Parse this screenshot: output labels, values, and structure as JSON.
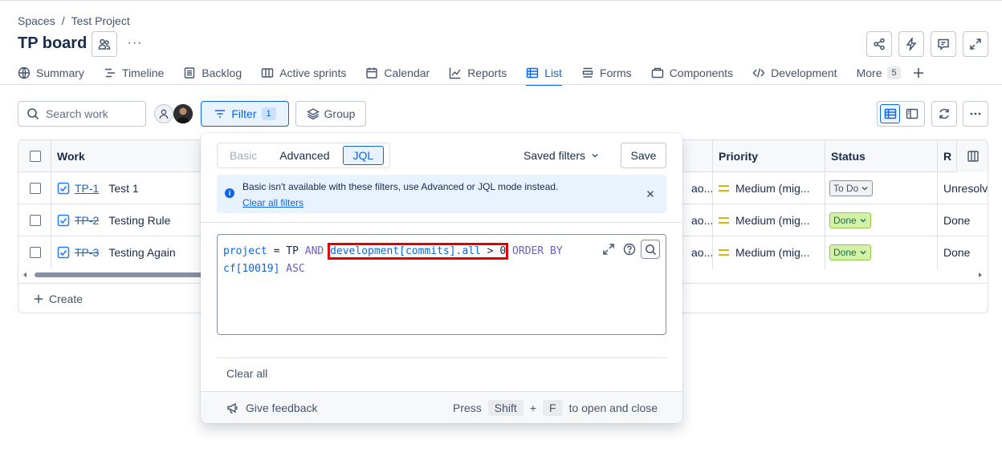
{
  "breadcrumb": {
    "root": "Spaces",
    "separator": "/",
    "project": "Test Project"
  },
  "board": {
    "title": "TP board",
    "more_label": "···"
  },
  "tabs": [
    {
      "label": "Summary",
      "icon": "globe-icon"
    },
    {
      "label": "Timeline",
      "icon": "timeline-icon"
    },
    {
      "label": "Backlog",
      "icon": "backlog-icon"
    },
    {
      "label": "Active sprints",
      "icon": "board-icon"
    },
    {
      "label": "Calendar",
      "icon": "calendar-icon"
    },
    {
      "label": "Reports",
      "icon": "chart-icon"
    },
    {
      "label": "List",
      "icon": "list-icon",
      "active": true
    },
    {
      "label": "Forms",
      "icon": "forms-icon"
    },
    {
      "label": "Components",
      "icon": "components-icon"
    },
    {
      "label": "Development",
      "icon": "code-icon"
    },
    {
      "label": "More",
      "count": "5"
    }
  ],
  "toolbar": {
    "search_placeholder": "Search work",
    "filter_label": "Filter",
    "filter_count": "1",
    "group_label": "Group"
  },
  "table": {
    "headers": {
      "work": "Work",
      "priority": "Priority",
      "status": "Status",
      "resolution": "R"
    },
    "rows": [
      {
        "key": "TP-1",
        "summary": "Test 1",
        "assignee_fragment": "ao...",
        "priority": "Medium (mig...",
        "status": "To Do",
        "resolution": "Unresolv",
        "done": false
      },
      {
        "key": "TP-2",
        "summary": "Testing Rule",
        "assignee_fragment": "ao...",
        "priority": "Medium (mig...",
        "status": "Done",
        "resolution": "Done",
        "done": true
      },
      {
        "key": "TP-3",
        "summary": "Testing Again",
        "assignee_fragment": "ao...",
        "priority": "Medium (mig...",
        "status": "Done",
        "resolution": "Done",
        "done": true
      }
    ],
    "create_label": "Create"
  },
  "filter_popup": {
    "modes": {
      "basic": "Basic",
      "advanced": "Advanced",
      "jql": "JQL"
    },
    "saved_filters_label": "Saved filters",
    "save_label": "Save",
    "info_message": "Basic isn't available with these filters, use Advanced or JQL mode instead.",
    "clear_filters_link": "Clear all filters",
    "jql": {
      "t1": "project",
      "t2": " = TP ",
      "t3": "AND",
      "t4": " ",
      "t5": "development[commits].all",
      "t6": " > 0",
      "t7": " ORDER BY",
      "t8": "cf[10019]",
      "t9": " ASC"
    },
    "clear_all_label": "Clear all",
    "feedback_label": "Give feedback",
    "shortcut": {
      "press": "Press",
      "key1": "Shift",
      "plus": "+",
      "key2": "F",
      "suffix": "to open and close"
    }
  },
  "colors": {
    "accent": "#0c66e4",
    "highlight": "#e00000",
    "done_lozenge": "#d3f1a7",
    "priority_medium": "#e2b203"
  }
}
